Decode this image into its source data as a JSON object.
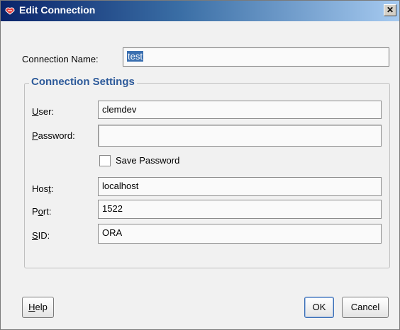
{
  "window": {
    "title": "Edit Connection",
    "close_glyph": "✕"
  },
  "connection_name": {
    "label": "Connection Name:",
    "value": "test"
  },
  "group": {
    "title": "Connection Settings"
  },
  "fields": {
    "user": {
      "label_mn": "U",
      "label_rest": "ser:",
      "value": "clemdev"
    },
    "password": {
      "label_mn": "P",
      "label_rest": "assword:",
      "value": ""
    },
    "save_password": {
      "label": "Save Password",
      "checked": false
    },
    "host": {
      "label_pre": "Hos",
      "label_mn": "t",
      "label_rest": ":",
      "value": "localhost"
    },
    "port": {
      "label_pre": "P",
      "label_mn": "o",
      "label_rest": "rt:",
      "value": "1522"
    },
    "sid": {
      "label_mn": "S",
      "label_rest": "ID:",
      "value": "ORA"
    }
  },
  "buttons": {
    "help_mn": "H",
    "help_rest": "elp",
    "ok": "OK",
    "cancel": "Cancel"
  },
  "colors": {
    "accent": "#2d5a9a",
    "selection": "#3a6fb0"
  }
}
